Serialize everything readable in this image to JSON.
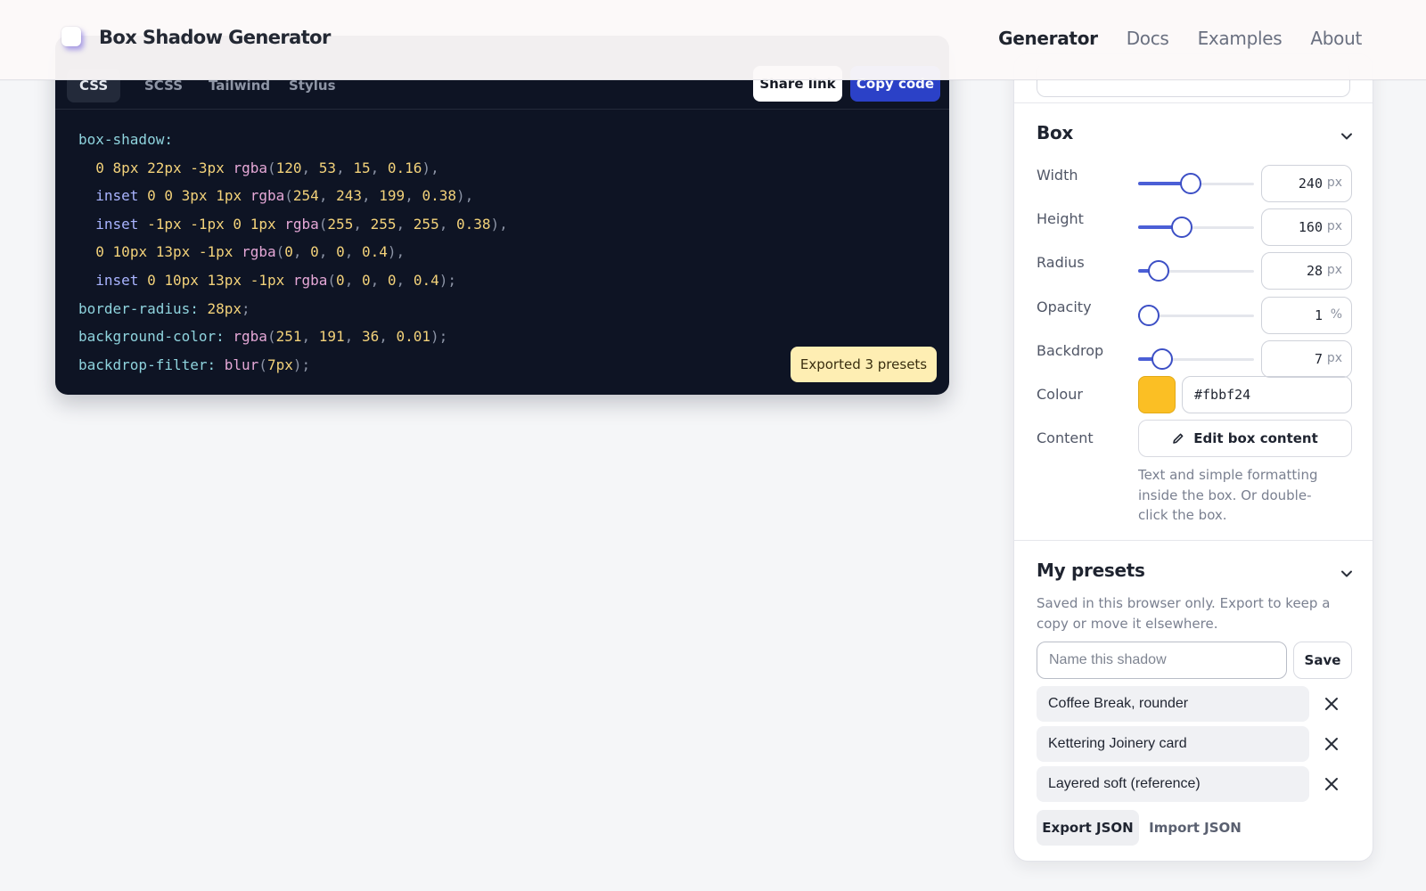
{
  "header": {
    "brand": "Box Shadow Generator",
    "nav": [
      "Generator",
      "Docs",
      "Examples",
      "About"
    ],
    "active_nav": "Generator"
  },
  "code_panel": {
    "tabs": [
      "CSS",
      "SCSS",
      "Tailwind",
      "Stylus"
    ],
    "active_tab": "CSS",
    "share_label": "Share link",
    "copy_label": "Copy code",
    "toast": "Exported 3 presets",
    "lines": [
      "box-shadow:",
      "  0 8px 22px -3px rgba(120, 53, 15, 0.16),",
      "  inset 0 0 3px 1px rgba(254, 243, 199, 0.38),",
      "  inset -1px -1px 0 1px rgba(255, 255, 255, 0.38),",
      "  0 10px 13px -1px rgba(0, 0, 0, 0.4),",
      "  inset 0 10px 13px -1px rgba(0, 0, 0, 0.4);",
      "border-radius: 28px;",
      "background-color: rgba(251, 191, 36, 0.01);",
      "backdrop-filter: blur(7px);"
    ]
  },
  "box": {
    "title": "Box",
    "controls": [
      {
        "label": "Width",
        "value": "240",
        "unit": "px",
        "fraction": 0.45
      },
      {
        "label": "Height",
        "value": "160",
        "unit": "px",
        "fraction": 0.38
      },
      {
        "label": "Radius",
        "value": "28",
        "unit": "px",
        "fraction": 0.18
      },
      {
        "label": "Opacity",
        "value": "1",
        "unit": "%",
        "fraction": 0.01
      },
      {
        "label": "Backdrop",
        "value": "7",
        "unit": "px",
        "fraction": 0.21
      }
    ],
    "colour_label": "Colour",
    "colour_value": "#fbbf24",
    "content_label": "Content",
    "edit_label": "Edit box content",
    "help": "Text and simple formatting inside the box. Or double-click the box."
  },
  "presets": {
    "title": "My presets",
    "help": "Saved in this browser only. Export to keep a copy or move it elsewhere.",
    "name_placeholder": "Name this shadow",
    "save_label": "Save",
    "items": [
      "Coffee Break, rounder",
      "Kettering Joinery card",
      "Layered soft (reference)"
    ],
    "export_label": "Export JSON",
    "import_label": "Import JSON"
  },
  "colors": {
    "accent": "#2b41c7",
    "slider": "#4b5fd6",
    "swatch": "#fbbf24",
    "toast": "#feeeb3",
    "code_bg": "#0e1424"
  }
}
